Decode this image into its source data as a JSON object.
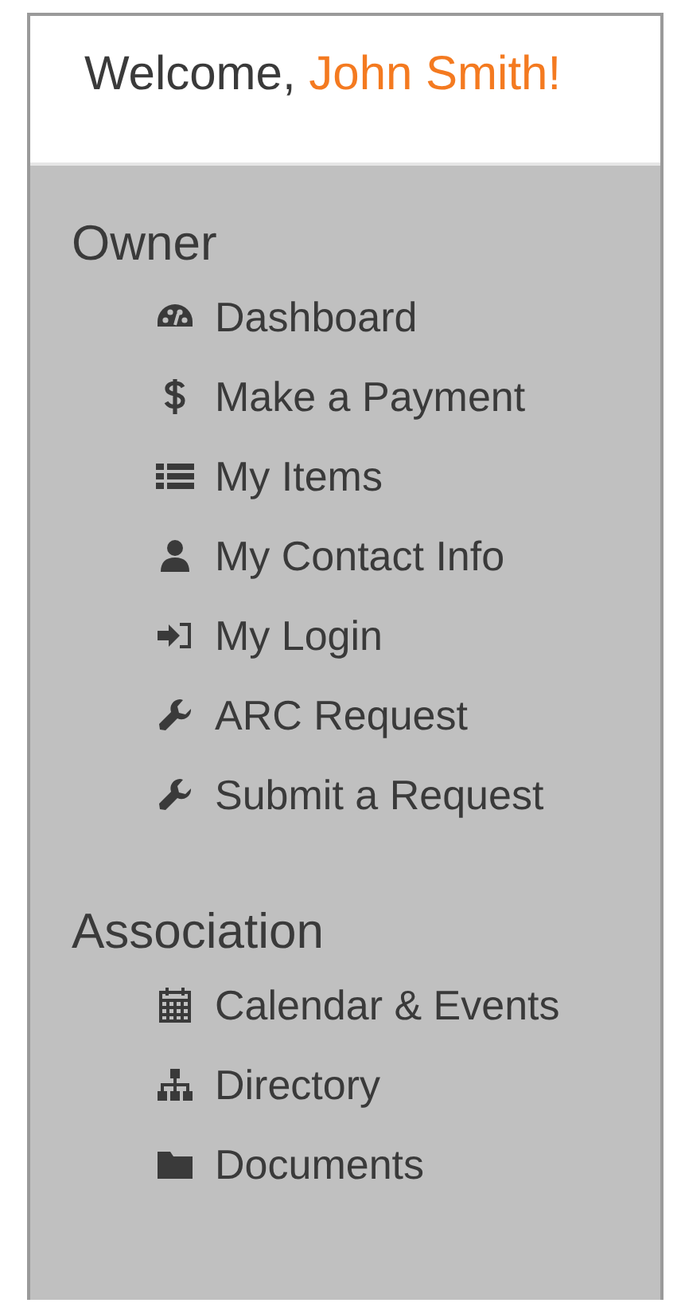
{
  "welcome": {
    "greeting": "Welcome,",
    "name": "John Smith!"
  },
  "sections": [
    {
      "title": "Owner",
      "items": [
        {
          "label": "Dashboard"
        },
        {
          "label": "Make a Payment"
        },
        {
          "label": "My Items"
        },
        {
          "label": "My Contact Info"
        },
        {
          "label": "My Login"
        },
        {
          "label": "ARC Request"
        },
        {
          "label": "Submit a Request"
        }
      ]
    },
    {
      "title": "Association",
      "items": [
        {
          "label": "Calendar & Events"
        },
        {
          "label": "Directory"
        },
        {
          "label": "Documents"
        }
      ]
    }
  ]
}
